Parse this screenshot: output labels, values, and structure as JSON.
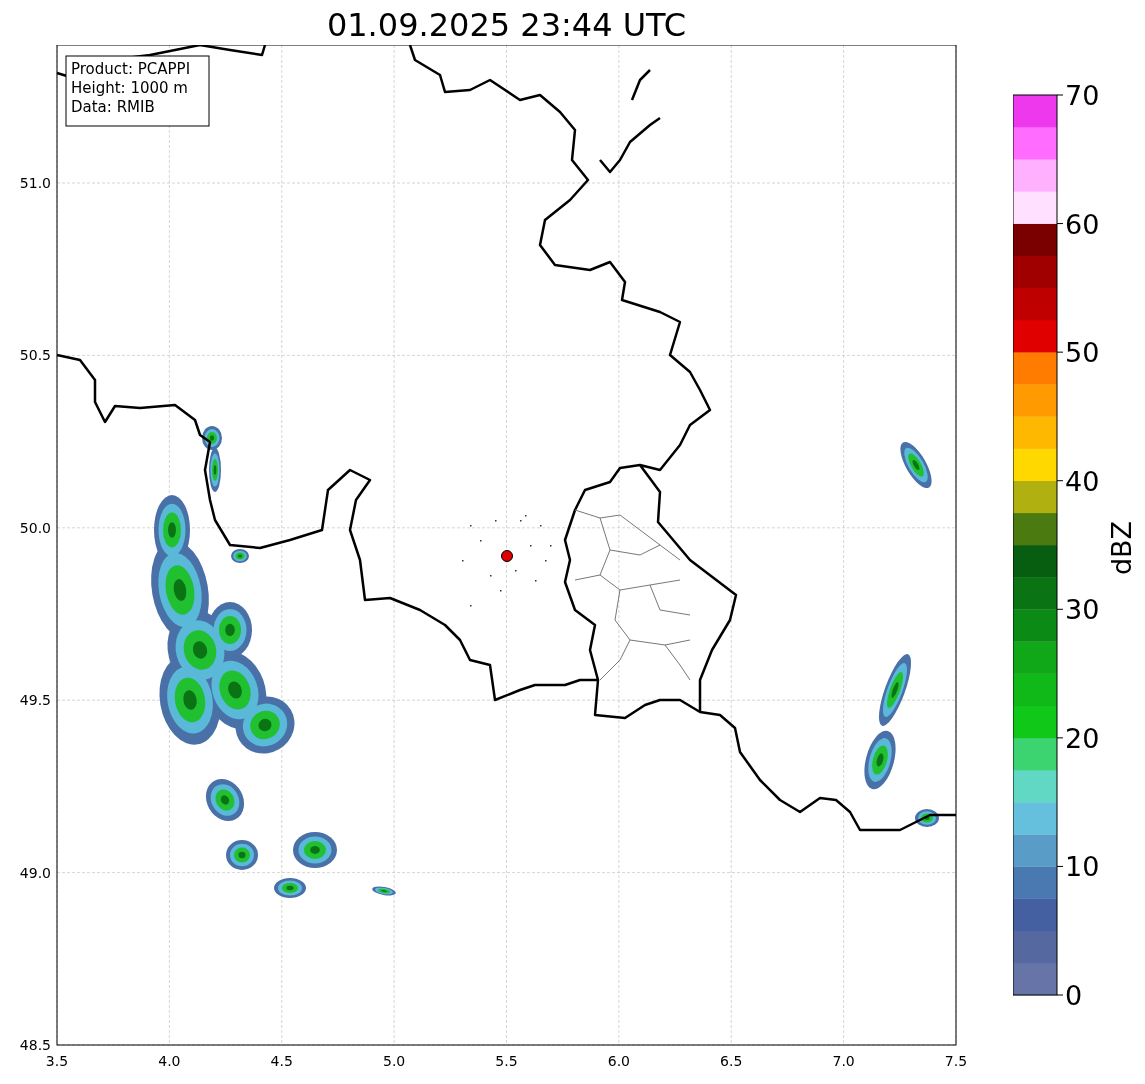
{
  "title": "01.09.2025 23:44 UTC",
  "map": {
    "info_box": [
      "Product: PCAPPI",
      "Height: 1000 m",
      "Data: RMIB"
    ],
    "xticks": [
      "3.5",
      "4.0",
      "4.5",
      "5.0",
      "5.5",
      "6.0",
      "6.5",
      "7.0",
      "7.5"
    ],
    "yticks": [
      "51.0",
      "50.5",
      "50.0",
      "49.5",
      "49.0",
      "48.5"
    ]
  },
  "colorbar": {
    "label": "dBZ",
    "ticks": [
      "70",
      "60",
      "50",
      "40",
      "30",
      "20",
      "10",
      "0"
    ],
    "bands": [
      {
        "color": "#6674a8"
      },
      {
        "color": "#5568a0"
      },
      {
        "color": "#4560a0"
      },
      {
        "color": "#4a78b0"
      },
      {
        "color": "#5a9cc8"
      },
      {
        "color": "#64c0dc"
      },
      {
        "color": "#60d8c4"
      },
      {
        "color": "#3cd470"
      },
      {
        "color": "#10c818"
      },
      {
        "color": "#10b818"
      },
      {
        "color": "#10a818"
      },
      {
        "color": "#0c8a16"
      },
      {
        "color": "#0a7414"
      },
      {
        "color": "#085e10"
      },
      {
        "color": "#4a7a10"
      },
      {
        "color": "#b0b010"
      },
      {
        "color": "#ffd800"
      },
      {
        "color": "#ffb800"
      },
      {
        "color": "#ff9a00"
      },
      {
        "color": "#ff7c00"
      },
      {
        "color": "#e00000"
      },
      {
        "color": "#c00000"
      },
      {
        "color": "#a00000"
      },
      {
        "color": "#7a0000"
      },
      {
        "color": "#ffe0ff"
      },
      {
        "color": "#ffb0ff"
      },
      {
        "color": "#ff6cff"
      },
      {
        "color": "#ee38ee"
      }
    ]
  }
}
